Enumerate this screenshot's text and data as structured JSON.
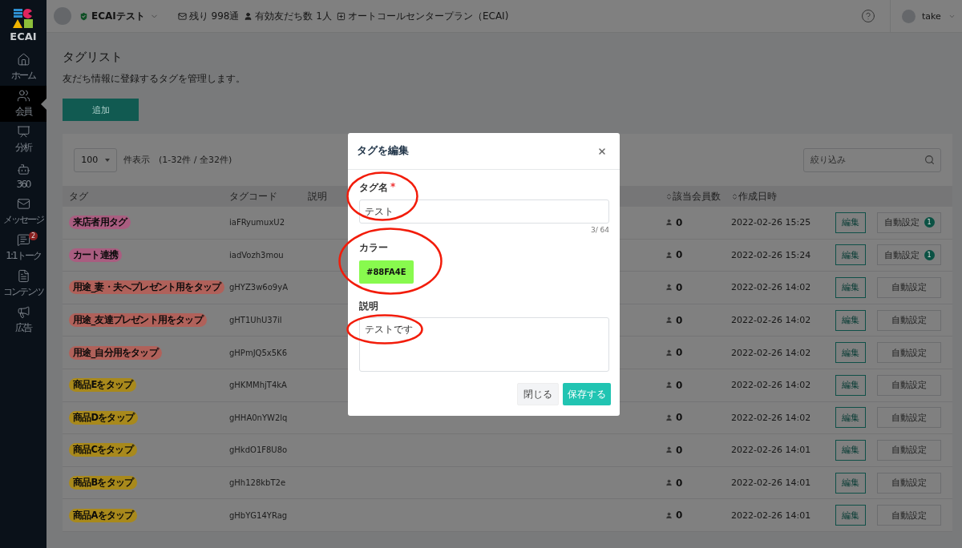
{
  "logo": {
    "text": "ECAI"
  },
  "sidebar": {
    "items": [
      {
        "label": "ホーム",
        "kind": "home",
        "selected": false
      },
      {
        "label": "会員",
        "kind": "members",
        "selected": true
      },
      {
        "label": "分析",
        "kind": "analytics",
        "selected": false
      },
      {
        "label": "360",
        "kind": "robot",
        "selected": false
      },
      {
        "label": "メッセージ",
        "kind": "message",
        "selected": false
      },
      {
        "label": "1:1トーク",
        "kind": "talk",
        "selected": false,
        "badge": "2"
      },
      {
        "label": "コンテンツ",
        "kind": "content",
        "selected": false
      },
      {
        "label": "広告",
        "kind": "ads",
        "selected": false
      }
    ]
  },
  "header": {
    "account": "ECAIテスト",
    "remaining": "残り 998通",
    "friends": "有効友だち数 1人",
    "plan": "オートコールセンタープラン（ECAI)",
    "user": "take"
  },
  "page": {
    "title": "タグリスト",
    "description": "友だち情報に登録するタグを管理します。",
    "add_button": "追加"
  },
  "table": {
    "page_size": "100",
    "count_text": "件表示　(1-32件 / 全32件)",
    "filter_placeholder": "絞り込み",
    "columns": [
      {
        "label": "タグ",
        "sortable": false
      },
      {
        "label": "タグコード",
        "sortable": false
      },
      {
        "label": "説明",
        "sortable": false
      },
      {
        "label": "該当会員数",
        "sortable": true
      },
      {
        "label": "作成日時",
        "sortable": true
      }
    ],
    "rows": [
      {
        "tag": "来店者用タグ",
        "color": "#a95d80",
        "code": "iaFRyumuxU2",
        "members": "0",
        "created": "2022-02-26 15:25",
        "edit": "編集",
        "auto": "自動設定",
        "auto_count": "1"
      },
      {
        "tag": "カート連携",
        "color": "#a95d80",
        "code": "iadVozh3mou",
        "members": "0",
        "created": "2022-02-26 15:24",
        "edit": "編集",
        "auto": "自動設定",
        "auto_count": "1"
      },
      {
        "tag": "用途_妻・夫へプレゼント用をタップ",
        "color": "#b0615a",
        "code": "gHYZ3w6o9yA",
        "members": "0",
        "created": "2022-02-26 14:02",
        "edit": "編集",
        "auto": "自動設定"
      },
      {
        "tag": "用途_友達プレゼント用をタップ",
        "color": "#b0615a",
        "code": "gHT1UhU37il",
        "members": "0",
        "created": "2022-02-26 14:02",
        "edit": "編集",
        "auto": "自動設定"
      },
      {
        "tag": "用途_自分用をタップ",
        "color": "#b0615a",
        "code": "gHPmJQ5x5K6",
        "members": "0",
        "created": "2022-02-26 14:02",
        "edit": "編集",
        "auto": "自動設定"
      },
      {
        "tag": "商品Eをタップ",
        "color": "#a8891c",
        "code": "gHKMMhjT4kA",
        "members": "0",
        "created": "2022-02-26 14:02",
        "edit": "編集",
        "auto": "自動設定"
      },
      {
        "tag": "商品Dをタップ",
        "color": "#a8891c",
        "code": "gHHA0nYW2lq",
        "members": "0",
        "created": "2022-02-26 14:02",
        "edit": "編集",
        "auto": "自動設定"
      },
      {
        "tag": "商品Cをタップ",
        "color": "#a8891c",
        "code": "gHkdO1F8U8o",
        "members": "0",
        "created": "2022-02-26 14:01",
        "edit": "編集",
        "auto": "自動設定"
      },
      {
        "tag": "商品Bをタップ",
        "color": "#a8891c",
        "code": "gHh128kbT2e",
        "members": "0",
        "created": "2022-02-26 14:01",
        "edit": "編集",
        "auto": "自動設定"
      },
      {
        "tag": "商品Aをタップ",
        "color": "#a8891c",
        "code": "gHbYG14YRag",
        "members": "0",
        "created": "2022-02-26 14:01",
        "edit": "編集",
        "auto": "自動設定"
      }
    ]
  },
  "modal": {
    "title": "タグを編集",
    "name": {
      "label": "タグ名",
      "required": "*",
      "value": "テスト",
      "counter": "3/ 64",
      "circled": true
    },
    "color": {
      "label": "カラー",
      "value": "#88FA4E",
      "color": "#88fa4e",
      "circled": true
    },
    "description": {
      "label": "説明",
      "value": "テストです",
      "circled": true
    },
    "buttons": {
      "close": "閉じる",
      "save": "保存する"
    }
  }
}
